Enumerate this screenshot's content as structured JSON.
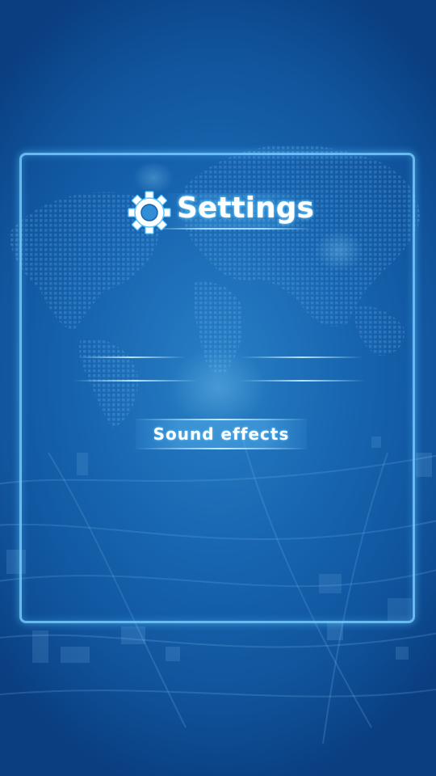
{
  "app": {
    "title": "Settings"
  },
  "settings": {
    "title": "Settings",
    "title_icon": "gear-icon",
    "options": [
      {
        "label": "Sound effects"
      }
    ]
  },
  "theme": {
    "background": "#1a69b3",
    "panel_border": "#78cdff",
    "text": "#ffffff"
  }
}
